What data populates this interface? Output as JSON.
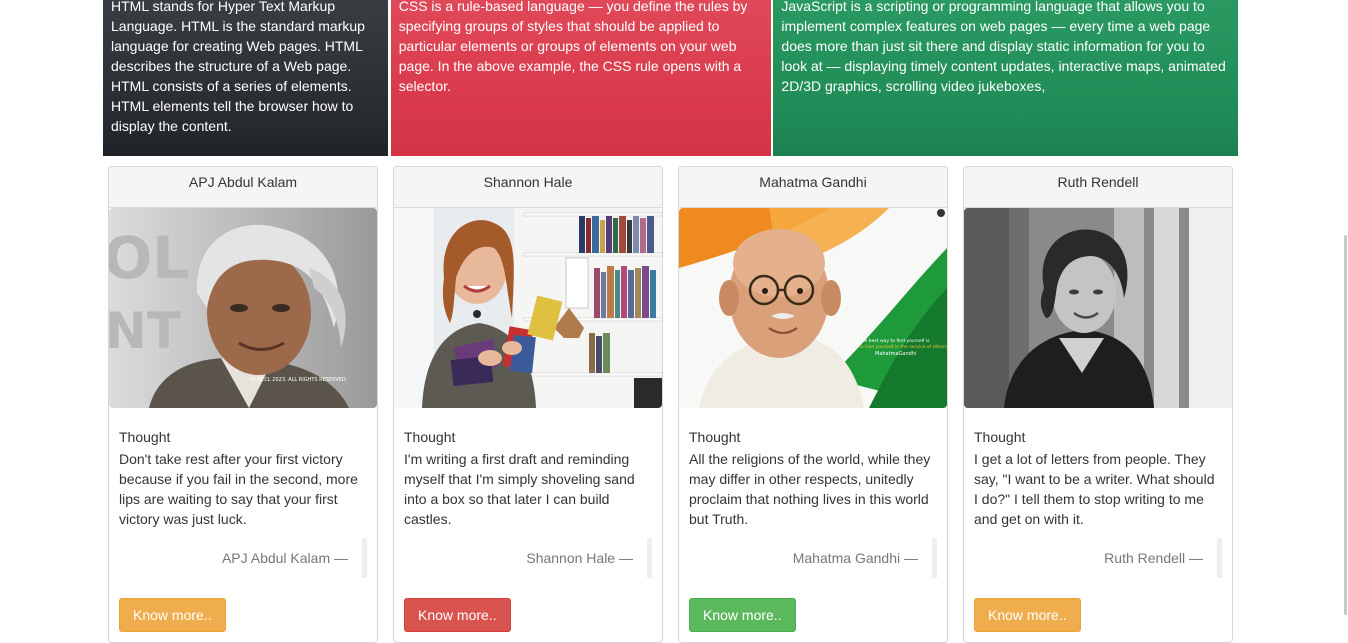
{
  "panels": [
    {
      "text": "HTML stands for Hyper Text Markup Language. HTML is the standard markup language for creating Web pages. HTML describes the structure of a Web page. HTML consists of a series of elements. HTML elements tell the browser how to display the content.",
      "color": "#272b30"
    },
    {
      "text": "CSS is a rule-based language — you define the rules by specifying groups of styles that should be applied to particular elements or groups of elements on your web page. In the above example, the CSS rule opens with a selector.",
      "color": "#d9394a"
    },
    {
      "text": "JavaScript is a scripting or programming language that allows you to implement complex features on web pages — every time a web page does more than just sit there and display static information for you to look at — displaying timely content updates, interactive maps, animated 2D/3D graphics, scrolling video jukeboxes,",
      "color": "#1f8a55"
    }
  ],
  "cards": [
    {
      "name": "APJ Abdul Kalam",
      "title": "Thought",
      "quote": "Don't take rest after your first victory because if you fail in the second, more lips are waiting to say that your first victory was just luck.",
      "author": "APJ Abdul Kalam —",
      "button": "Know more..",
      "button_color": "#f0ad4e",
      "photo_watermark": "© BCCL 2023. ALL RIGHTS RESERVED."
    },
    {
      "name": "Shannon Hale",
      "title": "Thought",
      "quote": "I'm writing a first draft and reminding myself that I'm simply shoveling sand into a box so that later I can build castles.",
      "author": "Shannon Hale —",
      "button": "Know more..",
      "button_color": "#d9534f"
    },
    {
      "name": "Mahatma Gandhi",
      "title": "Thought",
      "quote": "All the religions of the world, while they may differ in other respects, unitedly proclaim that nothing lives in this world but Truth.",
      "author": "Mahatma Gandhi —",
      "button": "Know more..",
      "button_color": "#5cb85c"
    },
    {
      "name": "Ruth Rendell",
      "title": "Thought",
      "quote": "I get a lot of letters from people. They say, \"I want to be a writer. What should I do?\" I tell them to stop writing to me and get on with it.",
      "author": "Ruth Rendell —",
      "button": "Know more..",
      "button_color": "#f0ad4e"
    }
  ]
}
